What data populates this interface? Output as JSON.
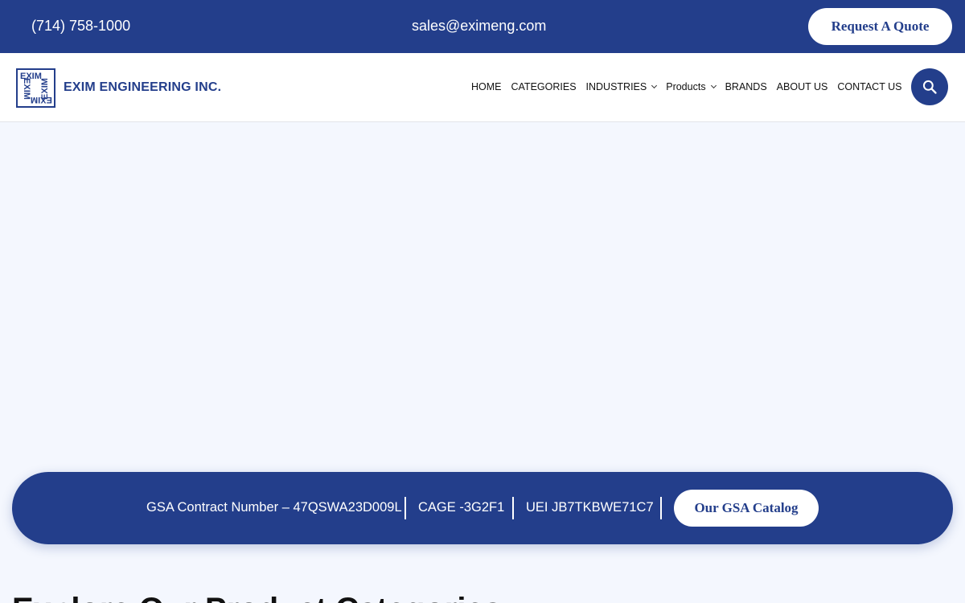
{
  "topbar": {
    "phone": "(714) 758-1000",
    "email": "sales@eximeng.com",
    "quote_label": "Request A Quote"
  },
  "header": {
    "logo_mark_text": "EXIM",
    "logo_text": "EXIM ENGINEERING INC.",
    "nav": [
      {
        "label": "HOME"
      },
      {
        "label": "CATEGORIES"
      },
      {
        "label": "INDUSTRIES",
        "dropdown": true
      },
      {
        "label": "Products",
        "dropdown": true
      },
      {
        "label": "BRANDS"
      },
      {
        "label": "ABOUT US"
      },
      {
        "label": "CONTACT US"
      }
    ],
    "search_icon": "search-icon"
  },
  "gsa": {
    "contract": "GSA Contract Number – 47QSWA23D009L",
    "cage": "CAGE -3G2F1",
    "uei": "UEI JB7TKBWE71C7",
    "catalog_label": "Our GSA Catalog"
  },
  "section": {
    "heading": "Explore Our Product Categories"
  },
  "colors": {
    "brand": "#233e8b",
    "page_bg": "#f4f7fe"
  }
}
